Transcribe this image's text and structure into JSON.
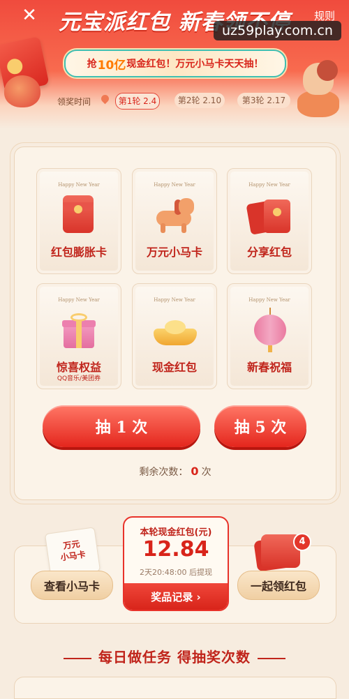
{
  "header": {
    "close_icon": "close-icon",
    "title": "元宝派红包 新春领不停",
    "rules_label": "规则",
    "watermark": "uz59play.com.cn",
    "promo": {
      "prefix": "抢",
      "highlight": "10亿",
      "suffix": "现金红包！万元小马卡天天抽！"
    }
  },
  "rounds": {
    "label": "领奖时间",
    "items": [
      {
        "label": "第1轮 2.4",
        "active": true
      },
      {
        "label": "第2轮 2.10",
        "active": false
      },
      {
        "label": "第3轮 2.17",
        "active": false
      }
    ]
  },
  "prizes": [
    {
      "tagline": "Happy New Year",
      "name": "红包膨胀卡",
      "sub": "",
      "icon": "red-envelope-icon"
    },
    {
      "tagline": "Happy New Year",
      "name": "万元小马卡",
      "sub": "",
      "icon": "horse-icon"
    },
    {
      "tagline": "Happy New Year",
      "name": "分享红包",
      "sub": "",
      "icon": "share-envelope-icon"
    },
    {
      "tagline": "Happy New Year",
      "name": "惊喜权益",
      "sub": "QQ音乐/美团券",
      "icon": "gift-box-icon"
    },
    {
      "tagline": "Happy New Year",
      "name": "现金红包",
      "sub": "",
      "icon": "gold-ingot-icon"
    },
    {
      "tagline": "Happy New Year",
      "name": "新春祝福",
      "sub": "",
      "icon": "lantern-icon"
    }
  ],
  "draw": {
    "once_label": "抽 1 次",
    "five_label": "抽 5 次",
    "remaining_prefix": "剩余次数：",
    "remaining_value": "0",
    "remaining_suffix": "次"
  },
  "cash": {
    "title": "本轮现金红包(元)",
    "amount": "12.84",
    "time_note": "2天20:48:00 后提现",
    "record_label": "奖品记录 ›"
  },
  "horse_card": {
    "mini_line1": "万元",
    "mini_line2": "小马卡",
    "button": "查看小马卡"
  },
  "together": {
    "button": "一起领红包",
    "badge": "4"
  },
  "tasks": {
    "title": "每日做任务  得抽奖次数"
  },
  "colors": {
    "primary_red": "#d8241a",
    "gold": "#f9cd6d",
    "background": "#f7ecdf"
  }
}
